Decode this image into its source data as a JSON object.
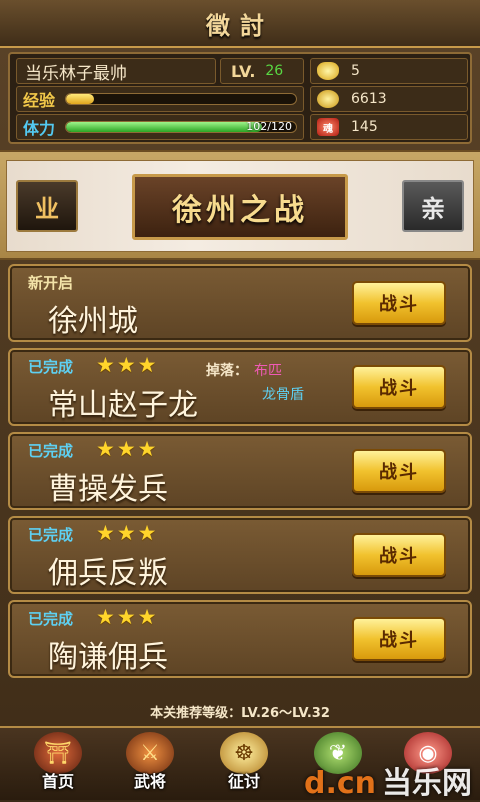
{
  "title": "徵討",
  "player": {
    "name": "当乐林子最帅",
    "level_label": "LV.",
    "level": "26",
    "exp_label": "经验",
    "exp_fraction": 0.12,
    "hp_label": "体力",
    "hp_text": "102/120",
    "hp_fraction": 0.85
  },
  "resources": [
    {
      "icon": "gold-ingot-icon",
      "value": "5"
    },
    {
      "icon": "coin-icon",
      "value": "6613"
    },
    {
      "icon": "soul-icon",
      "value": "145"
    }
  ],
  "chapter": {
    "title": "徐州之战",
    "prev_tab": "业",
    "next_tab": "亲"
  },
  "stages": [
    {
      "status": "新开启",
      "status_type": "new",
      "stars": 0,
      "name": "徐州城",
      "drop_label": "",
      "drops": [],
      "button": "战斗"
    },
    {
      "status": "已完成",
      "status_type": "done",
      "stars": 3,
      "name": "常山赵子龙",
      "drop_label": "掉落：",
      "drops": [
        "布匹",
        "龙骨盾"
      ],
      "button": "战斗"
    },
    {
      "status": "已完成",
      "status_type": "done",
      "stars": 3,
      "name": "曹操发兵",
      "drop_label": "",
      "drops": [],
      "button": "战斗"
    },
    {
      "status": "已完成",
      "status_type": "done",
      "stars": 3,
      "name": "佣兵反叛",
      "drop_label": "",
      "drops": [],
      "button": "战斗"
    },
    {
      "status": "已完成",
      "status_type": "done",
      "stars": 3,
      "name": "陶谦佣兵",
      "drop_label": "",
      "drops": [],
      "button": "战斗"
    }
  ],
  "recommend": "本关推荐等级：LV.26～LV.32",
  "nav": [
    {
      "label": "首页",
      "icon": "home-icon"
    },
    {
      "label": "武将",
      "icon": "general-icon"
    },
    {
      "label": "征讨",
      "icon": "campaign-icon"
    },
    {
      "label": "",
      "icon": "gourd-icon"
    },
    {
      "label": "",
      "icon": "lantern-icon"
    }
  ],
  "watermark": {
    "logo": "d.cn",
    "text": "当乐网"
  }
}
